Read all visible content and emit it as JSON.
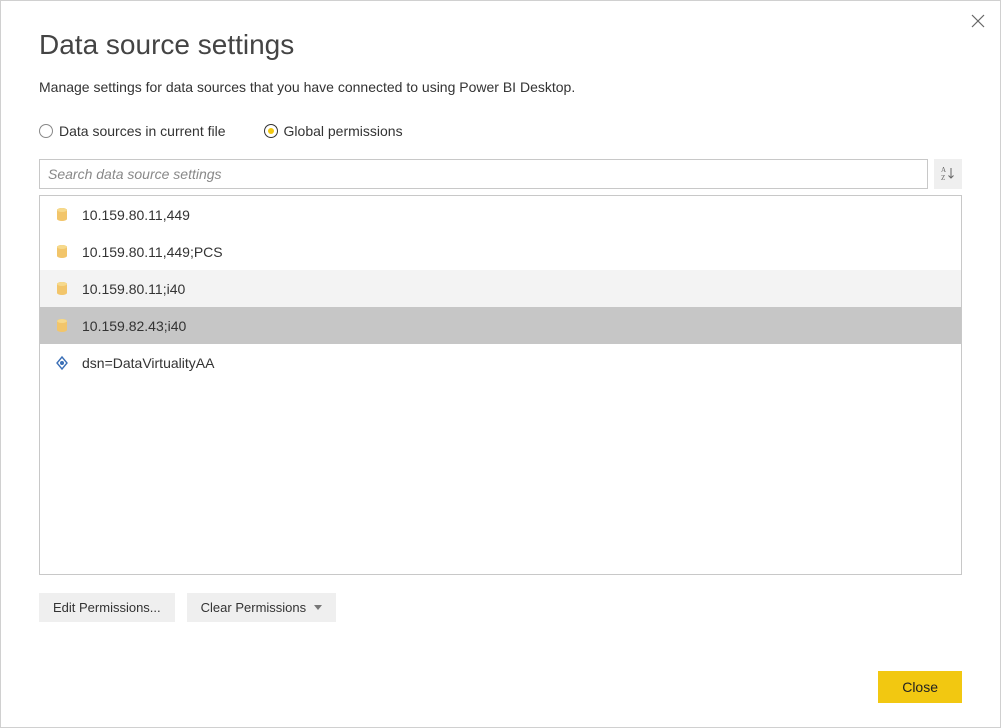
{
  "dialog": {
    "title": "Data source settings",
    "subtitle": "Manage settings for data sources that you have connected to using Power BI Desktop."
  },
  "scope": {
    "current_file_label": "Data sources in current file",
    "global_label": "Global permissions",
    "selected": "global"
  },
  "search": {
    "placeholder": "Search data source settings"
  },
  "data_sources": [
    {
      "label": "10.159.80.11,449",
      "icon": "database",
      "state": "normal"
    },
    {
      "label": "10.159.80.11,449;PCS",
      "icon": "database",
      "state": "normal"
    },
    {
      "label": "10.159.80.11;i40",
      "icon": "database",
      "state": "hover"
    },
    {
      "label": "10.159.82.43;i40",
      "icon": "database",
      "state": "selected"
    },
    {
      "label": "dsn=DataVirtualityAA",
      "icon": "odbc",
      "state": "normal"
    }
  ],
  "buttons": {
    "edit": "Edit Permissions...",
    "clear": "Clear Permissions",
    "close": "Close"
  }
}
